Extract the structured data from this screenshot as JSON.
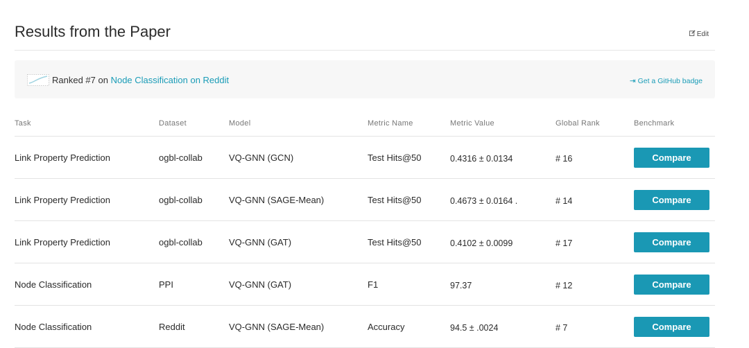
{
  "header": {
    "title": "Results from the Paper",
    "edit_label": "Edit"
  },
  "rank": {
    "prefix": "Ranked #7 on ",
    "link": "Node Classification on Reddit",
    "badge": "Get a GitHub badge"
  },
  "table": {
    "columns": [
      "Task",
      "Dataset",
      "Model",
      "Metric Name",
      "Metric Value",
      "Global Rank",
      "Benchmark"
    ],
    "rows": [
      {
        "task": "Link Property Prediction",
        "dataset": "ogbl-collab",
        "model": "VQ-GNN (GCN)",
        "metric": "Test Hits@50",
        "value": "0.4316 ± 0.0134",
        "rank": "# 16",
        "benchmark": "Compare"
      },
      {
        "task": "Link Property Prediction",
        "dataset": "ogbl-collab",
        "model": "VQ-GNN (SAGE-Mean)",
        "metric": "Test Hits@50",
        "value": "0.4673 ± 0.0164 .",
        "rank": "# 14",
        "benchmark": "Compare"
      },
      {
        "task": "Link Property Prediction",
        "dataset": "ogbl-collab",
        "model": "VQ-GNN (GAT)",
        "metric": "Test Hits@50",
        "value": "0.4102 ± 0.0099",
        "rank": "# 17",
        "benchmark": "Compare"
      },
      {
        "task": "Node Classification",
        "dataset": "PPI",
        "model": "VQ-GNN (GAT)",
        "metric": "F1",
        "value": "97.37",
        "rank": "# 12",
        "benchmark": "Compare"
      },
      {
        "task": "Node Classification",
        "dataset": "Reddit",
        "model": "VQ-GNN (SAGE-Mean)",
        "metric": "Accuracy",
        "value": "94.5 ± .0024",
        "rank": "# 7",
        "benchmark": "Compare"
      }
    ]
  },
  "colors": {
    "accent": "#1a9cb7",
    "button": "#1a98b4"
  }
}
